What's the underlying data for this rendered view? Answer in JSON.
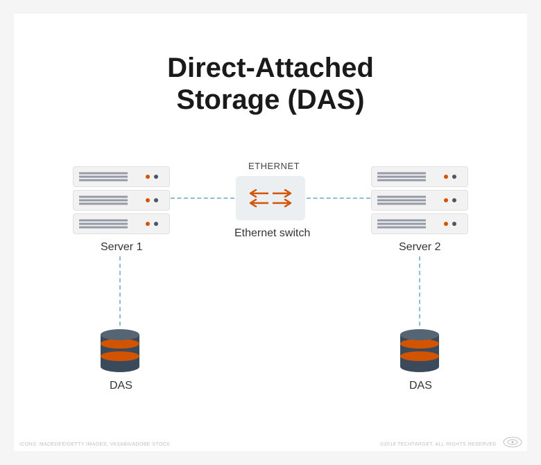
{
  "title_line1": "Direct-Attached",
  "title_line2": "Storage (DAS)",
  "labels": {
    "ethernet": "ETHERNET",
    "ethernet_switch": "Ethernet switch",
    "server1": "Server 1",
    "server2": "Server 2",
    "das1": "DAS",
    "das2": "DAS"
  },
  "footer": {
    "credits": "ICONS: MADEDEE/GETTY IMAGES, VASABII/ADOBE STOCK",
    "copyright": "©2018 TECHTARGET. ALL RIGHTS RESERVED",
    "brand": "TechTarget"
  },
  "colors": {
    "accent": "#d35400",
    "node": "#3a4a5a",
    "dash": "#8fbcd4"
  }
}
